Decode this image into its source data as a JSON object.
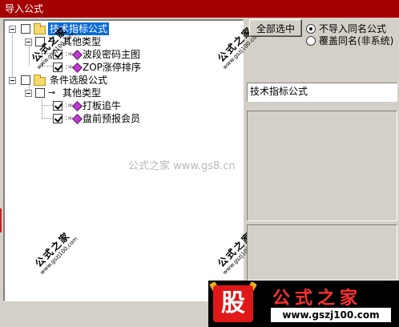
{
  "window": {
    "title": "导入公式"
  },
  "tree": {
    "nodes": [
      {
        "label": "技术指标公式",
        "checked": false,
        "selected": true
      },
      {
        "label": "其他类型",
        "checked": false
      },
      {
        "label": "波段密码主图",
        "checked": true
      },
      {
        "label": "ZOP涨停排序",
        "checked": true
      },
      {
        "label": "条件选股公式",
        "checked": false
      },
      {
        "label": "其他类型",
        "checked": false
      },
      {
        "label": "打板追牛",
        "checked": true
      },
      {
        "label": "盘前预报会员",
        "checked": true
      }
    ]
  },
  "toolbar": {
    "select_all_label": "全部选中"
  },
  "import_options": {
    "selected": "skip_same_name",
    "skip_same_name_label": "不导入同名公式",
    "overwrite_same_name_label": "覆盖同名(非系统)"
  },
  "formula_info": {
    "name": "技术指标公式"
  },
  "watermark": {
    "center_text": "公式之家 www.gs8.cn",
    "stamp_title": "公式之家",
    "stamp_url": "www.gszj100.com"
  },
  "logo": {
    "char": "股",
    "title": "公式之家",
    "url": "www.gszj100.com"
  },
  "colors": {
    "titlebar": "#a50000",
    "selection": "#0a6ad4",
    "dialog_bg": "#d4d0c8",
    "logo_red": "#e11818"
  }
}
